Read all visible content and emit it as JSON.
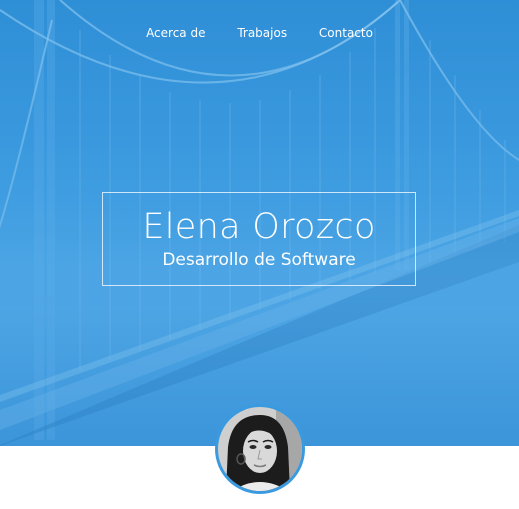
{
  "nav": {
    "items": [
      "Acerca de",
      "Trabajos",
      "Contacto"
    ]
  },
  "hero": {
    "name": "Elena Orozco",
    "role": "Desarrollo de Software",
    "background_icon": "suspension-bridge-photo"
  },
  "profile": {
    "photo_icon": "profile-photo"
  },
  "colors": {
    "hero_blue": "#3a9ae0",
    "text": "#ffffff",
    "page": "#ffffff"
  }
}
